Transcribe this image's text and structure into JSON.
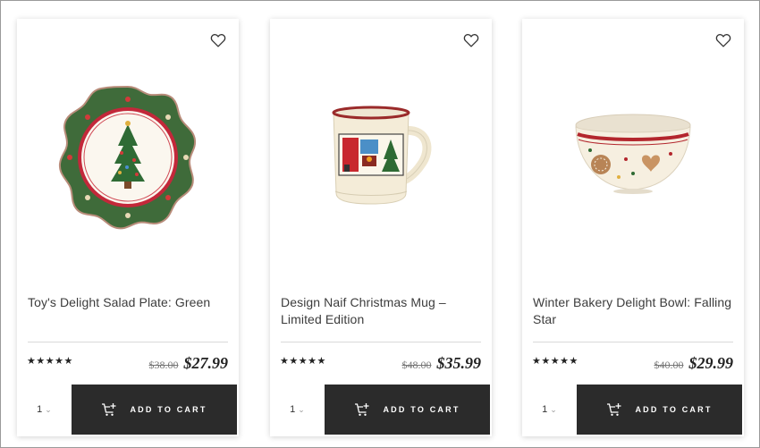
{
  "products": [
    {
      "title": "Toy's Delight Salad Plate: Green",
      "rating": "★★★★★",
      "old_price": "$38.00",
      "price": "$27.99",
      "qty": "1",
      "cart_label": "ADD TO CART"
    },
    {
      "title": "Design Naif Christmas Mug – Limited Edition",
      "rating": "★★★★★",
      "old_price": "$48.00",
      "price": "$35.99",
      "qty": "1",
      "cart_label": "ADD TO CART"
    },
    {
      "title": "Winter Bakery Delight Bowl: Falling Star",
      "rating": "★★★★★",
      "old_price": "$40.00",
      "price": "$29.99",
      "qty": "1",
      "cart_label": "ADD TO CART"
    }
  ],
  "colors": {
    "cart_button": "#2b2b2b",
    "plate_green": "#3f6b3a",
    "accent_red": "#b3262d"
  },
  "icons": [
    "heart-outline-icon",
    "cart-add-icon",
    "chevron-down-icon"
  ]
}
